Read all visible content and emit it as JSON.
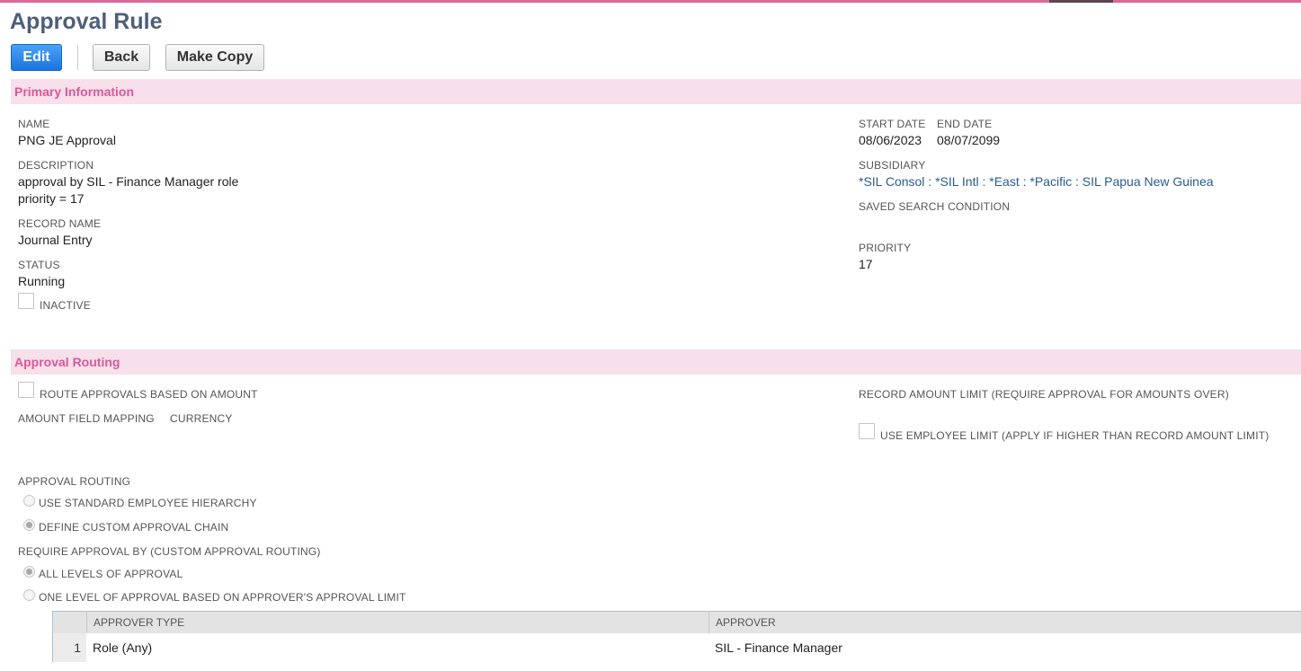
{
  "page": {
    "title": "Approval Rule"
  },
  "toolbar": {
    "edit_label": "Edit",
    "back_label": "Back",
    "copy_label": "Make Copy"
  },
  "primary": {
    "section_title": "Primary Information",
    "name_label": "NAME",
    "name_value": "PNG JE Approval",
    "description_label": "DESCRIPTION",
    "description_line1": "approval by SIL - Finance Manager role",
    "description_line2": "priority = 17",
    "record_name_label": "RECORD NAME",
    "record_name_value": "Journal Entry",
    "status_label": "STATUS",
    "status_value": "Running",
    "inactive_label": "INACTIVE",
    "inactive_checked": false,
    "start_date_label": "START DATE",
    "start_date_value": "08/06/2023",
    "end_date_label": "END DATE",
    "end_date_value": "08/07/2099",
    "subsidiary_label": "SUBSIDIARY",
    "subsidiary_value": "*SIL Consol : *SIL Intl : *East : *Pacific : SIL Papua New Guinea",
    "saved_search_label": "SAVED SEARCH CONDITION",
    "priority_label": "PRIORITY",
    "priority_value": "17"
  },
  "routing": {
    "section_title": "Approval Routing",
    "route_amount_label": "ROUTE APPROVALS BASED ON AMOUNT",
    "route_amount_checked": false,
    "amount_field_label": "AMOUNT FIELD MAPPING",
    "currency_label": "CURRENCY",
    "record_amount_label": "RECORD AMOUNT LIMIT (REQUIRE APPROVAL FOR AMOUNTS OVER)",
    "employee_limit_label": "USE EMPLOYEE LIMIT (APPLY IF HIGHER THAN RECORD AMOUNT LIMIT)",
    "employee_limit_checked": false,
    "approval_routing_label": "APPROVAL ROUTING",
    "option_standard": "USE STANDARD EMPLOYEE HIERARCHY",
    "option_custom": "DEFINE CUSTOM APPROVAL CHAIN",
    "selected_routing": "custom",
    "require_by_label": "REQUIRE APPROVAL BY (CUSTOM APPROVAL ROUTING)",
    "option_all_levels": "ALL LEVELS OF APPROVAL",
    "option_one_level": "ONE LEVEL OF APPROVAL BASED ON APPROVER'S APPROVAL LIMIT",
    "selected_require": "all"
  },
  "approvers": {
    "columns": [
      "APPROVER TYPE",
      "APPROVER"
    ],
    "rows": [
      {
        "num": "1",
        "type": "Role (Any)",
        "approver": "SIL - Finance Manager"
      }
    ]
  }
}
